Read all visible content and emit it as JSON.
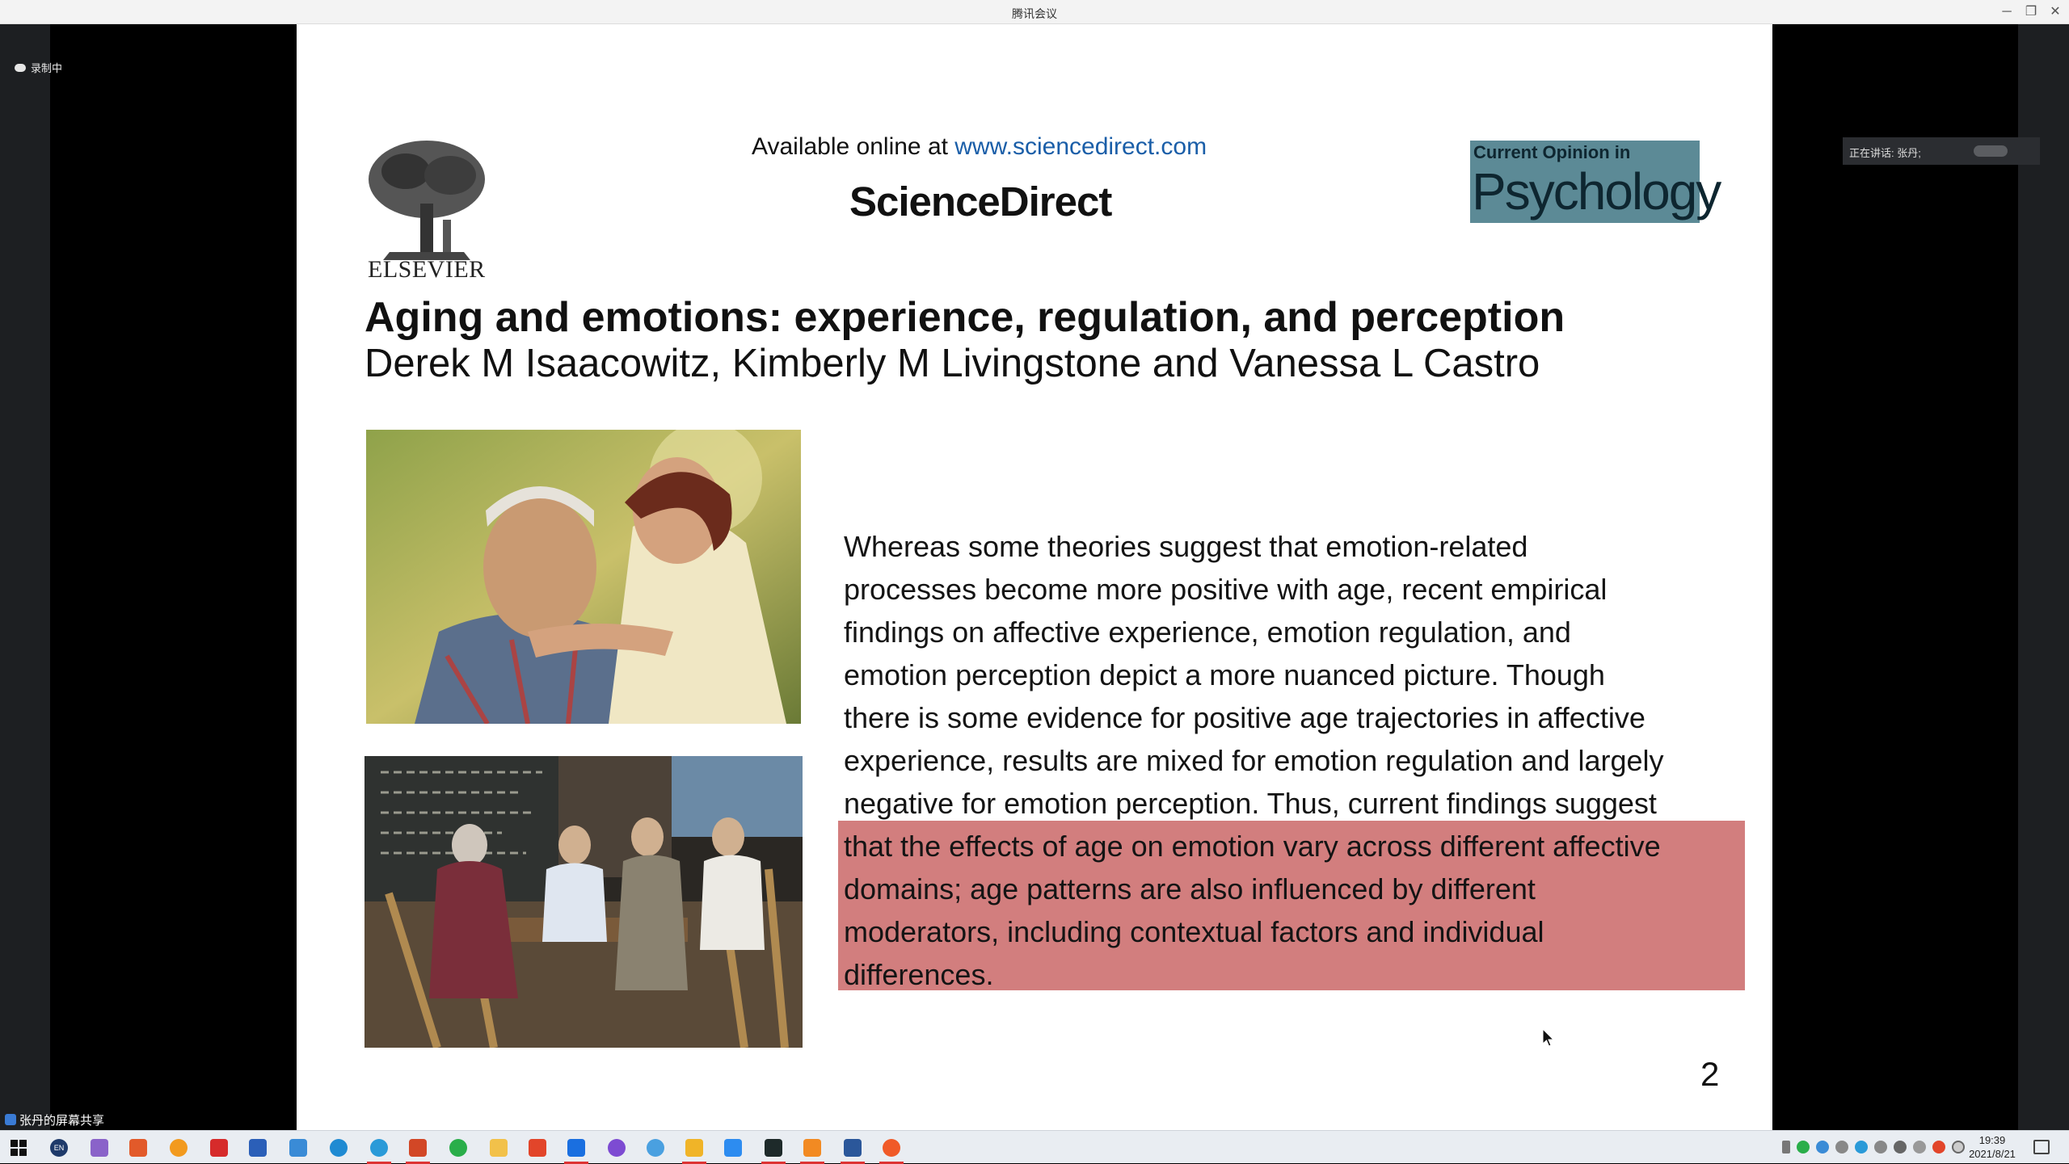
{
  "window": {
    "title": "腾讯会议",
    "minimize": "─",
    "restore": "❐",
    "close": "✕"
  },
  "meeting": {
    "recording_label": "录制中",
    "speaker_label": "正在讲话: 张丹;",
    "share_label": "张丹的屏幕共享"
  },
  "slide": {
    "publisher": "ELSEVIER",
    "available_prefix": "Available online at ",
    "available_link": "www.sciencedirect.com",
    "platform": "ScienceDirect",
    "journal_line1": "Current Opinion in",
    "journal_line2": "Psychology",
    "title": "Aging and emotions: experience, regulation, and perception",
    "authors": "Derek M Isaacowitz, Kimberly M Livingstone and Vanessa L Castro",
    "abstract_lines": [
      "Whereas some theories suggest that emotion-related",
      "processes become more positive with age, recent empirical",
      "findings on affective experience, emotion regulation, and",
      "emotion perception depict a more nuanced picture. Though",
      "there is some evidence for positive age trajectories in affective",
      "experience, results are mixed for emotion regulation and largely",
      "negative for emotion perception. Thus, current findings suggest",
      "that the effects of age on emotion vary across different affective",
      "domains; age patterns are also influenced by different",
      "moderators, including contextual factors and individual",
      "differences."
    ],
    "page_number": "2",
    "highlight_color": "#d27e7e"
  },
  "taskbar": {
    "time": "19:39",
    "date": "2021/8/21",
    "lang_icon": "EN"
  }
}
